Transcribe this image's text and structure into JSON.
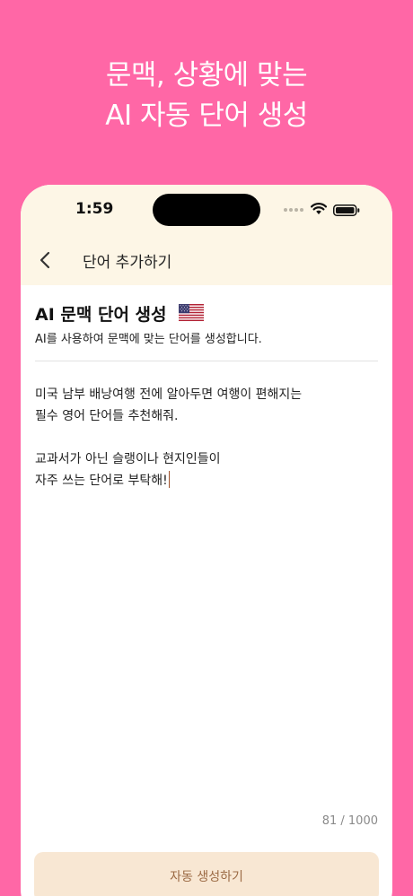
{
  "promo": {
    "line1": "문맥, 상황에 맞는",
    "line2": "AI 자동 단어 생성"
  },
  "status_bar": {
    "time": "1:59",
    "icons": [
      "signal-icon",
      "wifi-icon",
      "battery-icon"
    ]
  },
  "nav": {
    "back_icon": "chevron-left-icon",
    "title": "단어 추가하기"
  },
  "section": {
    "title": "AI 문맥 단어 생성",
    "flag_icon": "us-flag-icon",
    "description": "AI를 사용하여 문맥에 맞는 단어를 생성합니다."
  },
  "prompt": {
    "value": "미국 남부 배낭여행 전에 알아두면 여행이 편해지는\n필수 영어 단어들 추천해줘.\n\n교과서가 아닌 슬랭이나 현지인들이\n자주 쓰는 단어로 부탁해!"
  },
  "counter": "81 / 1000",
  "button": {
    "label": "자동 생성하기"
  },
  "colors": {
    "background": "#ff67a6",
    "header_bg": "#fdf6e6",
    "button_bg": "#f8e7d3",
    "button_text": "#9c6b45",
    "caret": "#a0522d"
  }
}
